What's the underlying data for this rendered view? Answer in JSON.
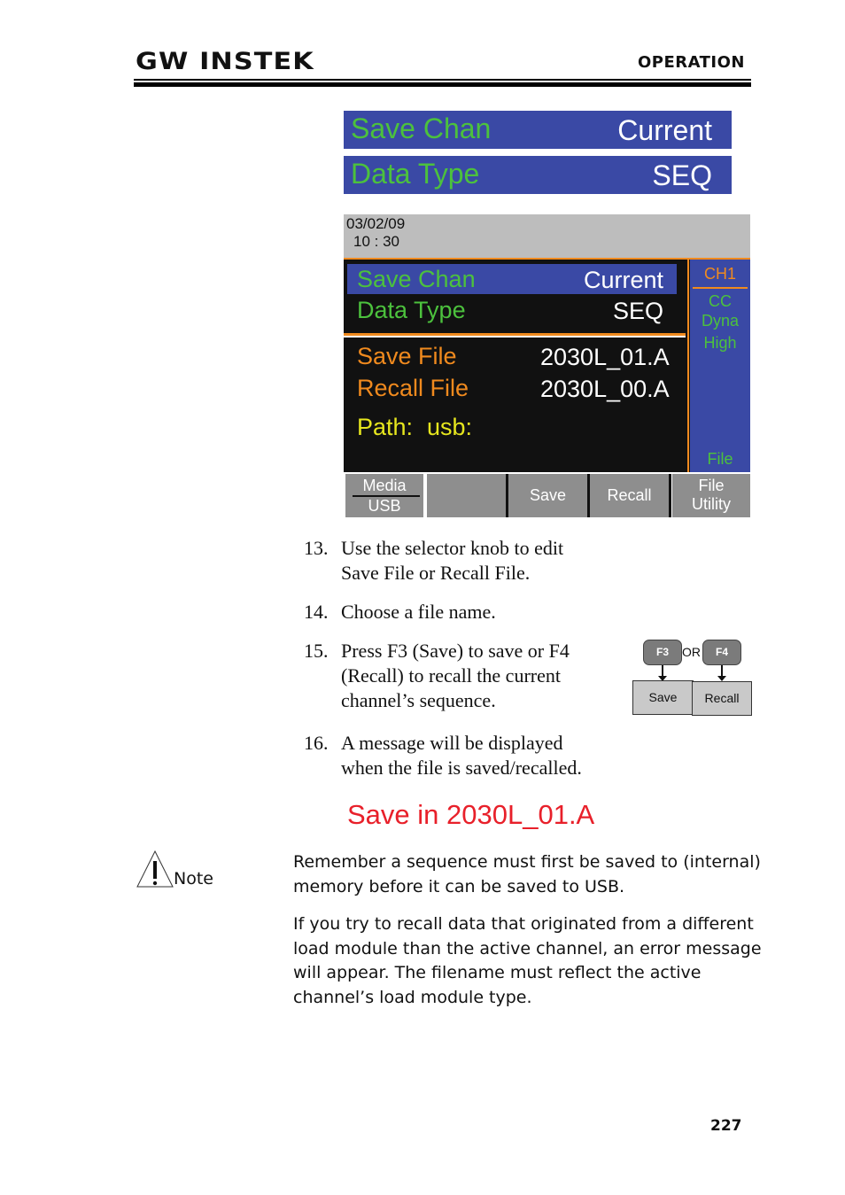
{
  "header": {
    "logo": "GW INSTEK",
    "section": "OPERATION"
  },
  "settings": [
    {
      "label": "Save Chan",
      "value": "Current"
    },
    {
      "label": "Data Type",
      "value": "SEQ"
    }
  ],
  "screen": {
    "date": "03/02/09",
    "time": "10 : 30",
    "main": {
      "save_chan_label": "Save Chan",
      "save_chan_value": "Current",
      "data_type_label": "Data Type",
      "data_type_value": "SEQ",
      "save_file_label": "Save File",
      "save_file_value": "2030L_01.A",
      "recall_file_label": "Recall File",
      "recall_file_value": "2030L_00.A",
      "path_label": "Path:",
      "path_value": "usb:"
    },
    "side": {
      "channel": "CH1",
      "mode": "CC",
      "sub_mode": "Dyna",
      "range": "High",
      "menu": "File"
    },
    "softkeys": {
      "f1_top": "Media",
      "f1_bottom": "USB",
      "f2": "",
      "f3": "Save",
      "f4": "Recall",
      "f5_line1": "File",
      "f5_line2": "Utility"
    }
  },
  "steps": [
    {
      "num": "13.",
      "lines": [
        "Use the selector knob to edit",
        "Save File or Recall File."
      ]
    },
    {
      "num": "14.",
      "lines": [
        "Choose a file name."
      ]
    },
    {
      "num": "15.",
      "lines": [
        "Press F3 (Save) to save or F4",
        "(Recall) to recall the current",
        "channel’s sequence."
      ]
    },
    {
      "num": "16.",
      "lines": [
        "A message will be displayed",
        "when the file is saved/recalled."
      ]
    }
  ],
  "key_diagram": {
    "key1": "F3",
    "or": "OR",
    "key2": "F4",
    "action1": "Save",
    "action2": "Recall"
  },
  "message": "Save in 2030L_01.A",
  "note": {
    "label": "Note",
    "paragraphs": [
      [
        "Remember a sequence must first be saved to (internal)",
        "memory before it can be saved to USB."
      ],
      [
        "If you try to recall data that originated from a different",
        "load module than the active channel, an error message",
        "will appear. The filename must reflect the active",
        "channel’s load module type."
      ]
    ]
  },
  "page_number": "227",
  "colors": {
    "panel_blue": "#3a49a5",
    "label_green": "#4cc13d",
    "accent_orange": "#f08a1e",
    "path_yellow": "#e6e61e",
    "message_red": "#e8202a"
  }
}
